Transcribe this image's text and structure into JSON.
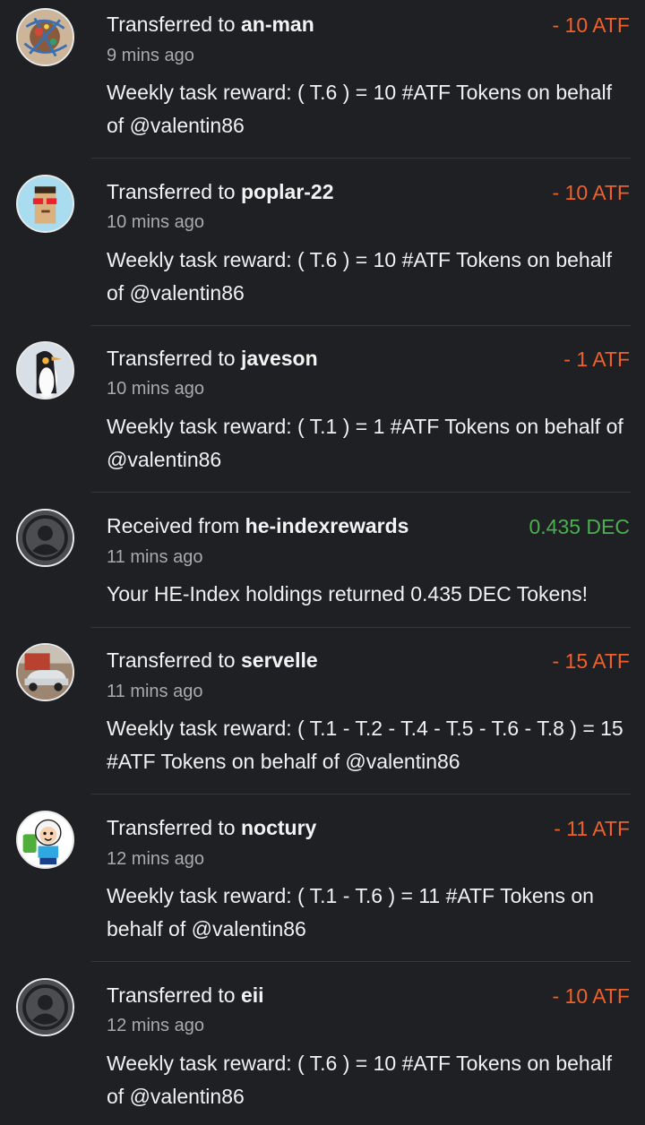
{
  "colors": {
    "background": "#1e2024",
    "outgoing_amount": "#f0602a",
    "incoming_amount": "#4caf50",
    "secondary_text": "#a9aaad"
  },
  "transactions": [
    {
      "direction_label": "Transferred to",
      "user": "an-man",
      "amount": "- 10 ATF",
      "kind": "out",
      "time": "9 mins ago",
      "memo": "Weekly task reward: ( T.6 ) = 10 #ATF Tokens on behalf of @valentin86",
      "avatar_icon": "colorful-art-avatar"
    },
    {
      "direction_label": "Transferred to",
      "user": "poplar-22",
      "amount": "- 10 ATF",
      "kind": "out",
      "time": "10 mins ago",
      "memo": "Weekly task reward: ( T.6 ) = 10 #ATF Tokens on behalf of @valentin86",
      "avatar_icon": "pixel-punk-avatar"
    },
    {
      "direction_label": "Transferred to",
      "user": "javeson",
      "amount": "- 1 ATF",
      "kind": "out",
      "time": "10 mins ago",
      "memo": "Weekly task reward: ( T.1 ) = 1 #ATF Tokens on behalf of @valentin86",
      "avatar_icon": "penguin-avatar"
    },
    {
      "direction_label": "Received from",
      "user": "he-indexrewards",
      "amount": "0.435 DEC",
      "kind": "in",
      "time": "11 mins ago",
      "memo": "Your HE-Index holdings returned 0.435 DEC Tokens!",
      "avatar_icon": "default-user-avatar"
    },
    {
      "direction_label": "Transferred to",
      "user": "servelle",
      "amount": "- 15 ATF",
      "kind": "out",
      "time": "11 mins ago",
      "memo": "Weekly task reward: ( T.1 - T.2 - T.4 - T.5 - T.6 - T.8 ) = 15 #ATF Tokens on behalf of @valentin86",
      "avatar_icon": "car-photo-avatar"
    },
    {
      "direction_label": "Transferred to",
      "user": "noctury",
      "amount": "- 11 ATF",
      "kind": "out",
      "time": "12 mins ago",
      "memo": "Weekly task reward: ( T.1 - T.6 ) = 11 #ATF Tokens on behalf of @valentin86",
      "avatar_icon": "cartoon-character-avatar"
    },
    {
      "direction_label": "Transferred to",
      "user": "eii",
      "amount": "- 10 ATF",
      "kind": "out",
      "time": "12 mins ago",
      "memo": "Weekly task reward: ( T.6 ) = 10 #ATF Tokens on behalf of @valentin86",
      "avatar_icon": "default-user-avatar"
    }
  ]
}
